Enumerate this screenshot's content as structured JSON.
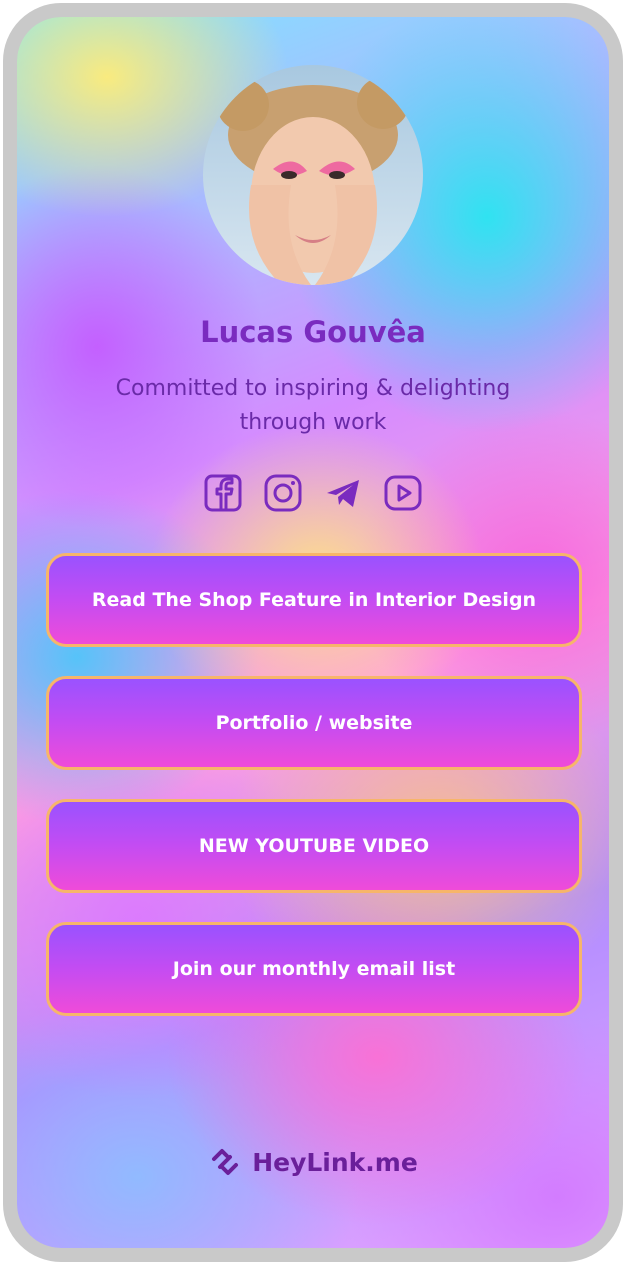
{
  "profile": {
    "avatar_alt": "Profile photo",
    "name": "Lucas Gouvêa",
    "bio": "Committed to inspiring & delighting through work"
  },
  "socials": [
    {
      "icon": "facebook-icon"
    },
    {
      "icon": "instagram-icon"
    },
    {
      "icon": "telegram-icon"
    },
    {
      "icon": "youtube-icon"
    }
  ],
  "links": [
    {
      "label": "Read The Shop Feature in Interior Design"
    },
    {
      "label": "Portfolio / website"
    },
    {
      "label": "NEW YOUTUBE VIDEO"
    },
    {
      "label": "Join our monthly email list"
    }
  ],
  "footer": {
    "brand": "HeyLink.me"
  },
  "colors": {
    "accent": "#7a2bbf",
    "button_top": "#9a52ff",
    "button_bottom": "#ef4bd9",
    "button_border": "#f7b56a",
    "device_frame": "#c9c9c9"
  }
}
